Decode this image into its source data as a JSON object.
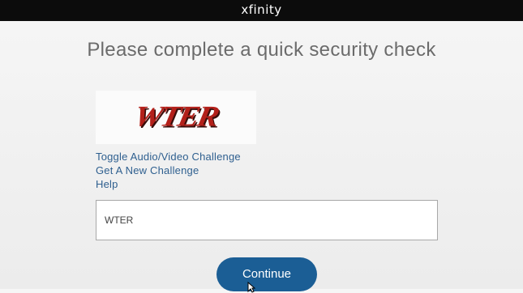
{
  "header": {
    "brand": "xfinity"
  },
  "main": {
    "heading": "Please complete a quick security check",
    "captcha": {
      "image_text": "WTER"
    },
    "links": {
      "toggle": "Toggle Audio/Video Challenge",
      "new_challenge": "Get A New Challenge",
      "help": "Help"
    },
    "answer_input": {
      "value": "WTER"
    },
    "continue_label": "Continue"
  },
  "colors": {
    "header_bg": "#0c0c0c",
    "link": "#2e5f8f",
    "button": "#1b5e95"
  }
}
